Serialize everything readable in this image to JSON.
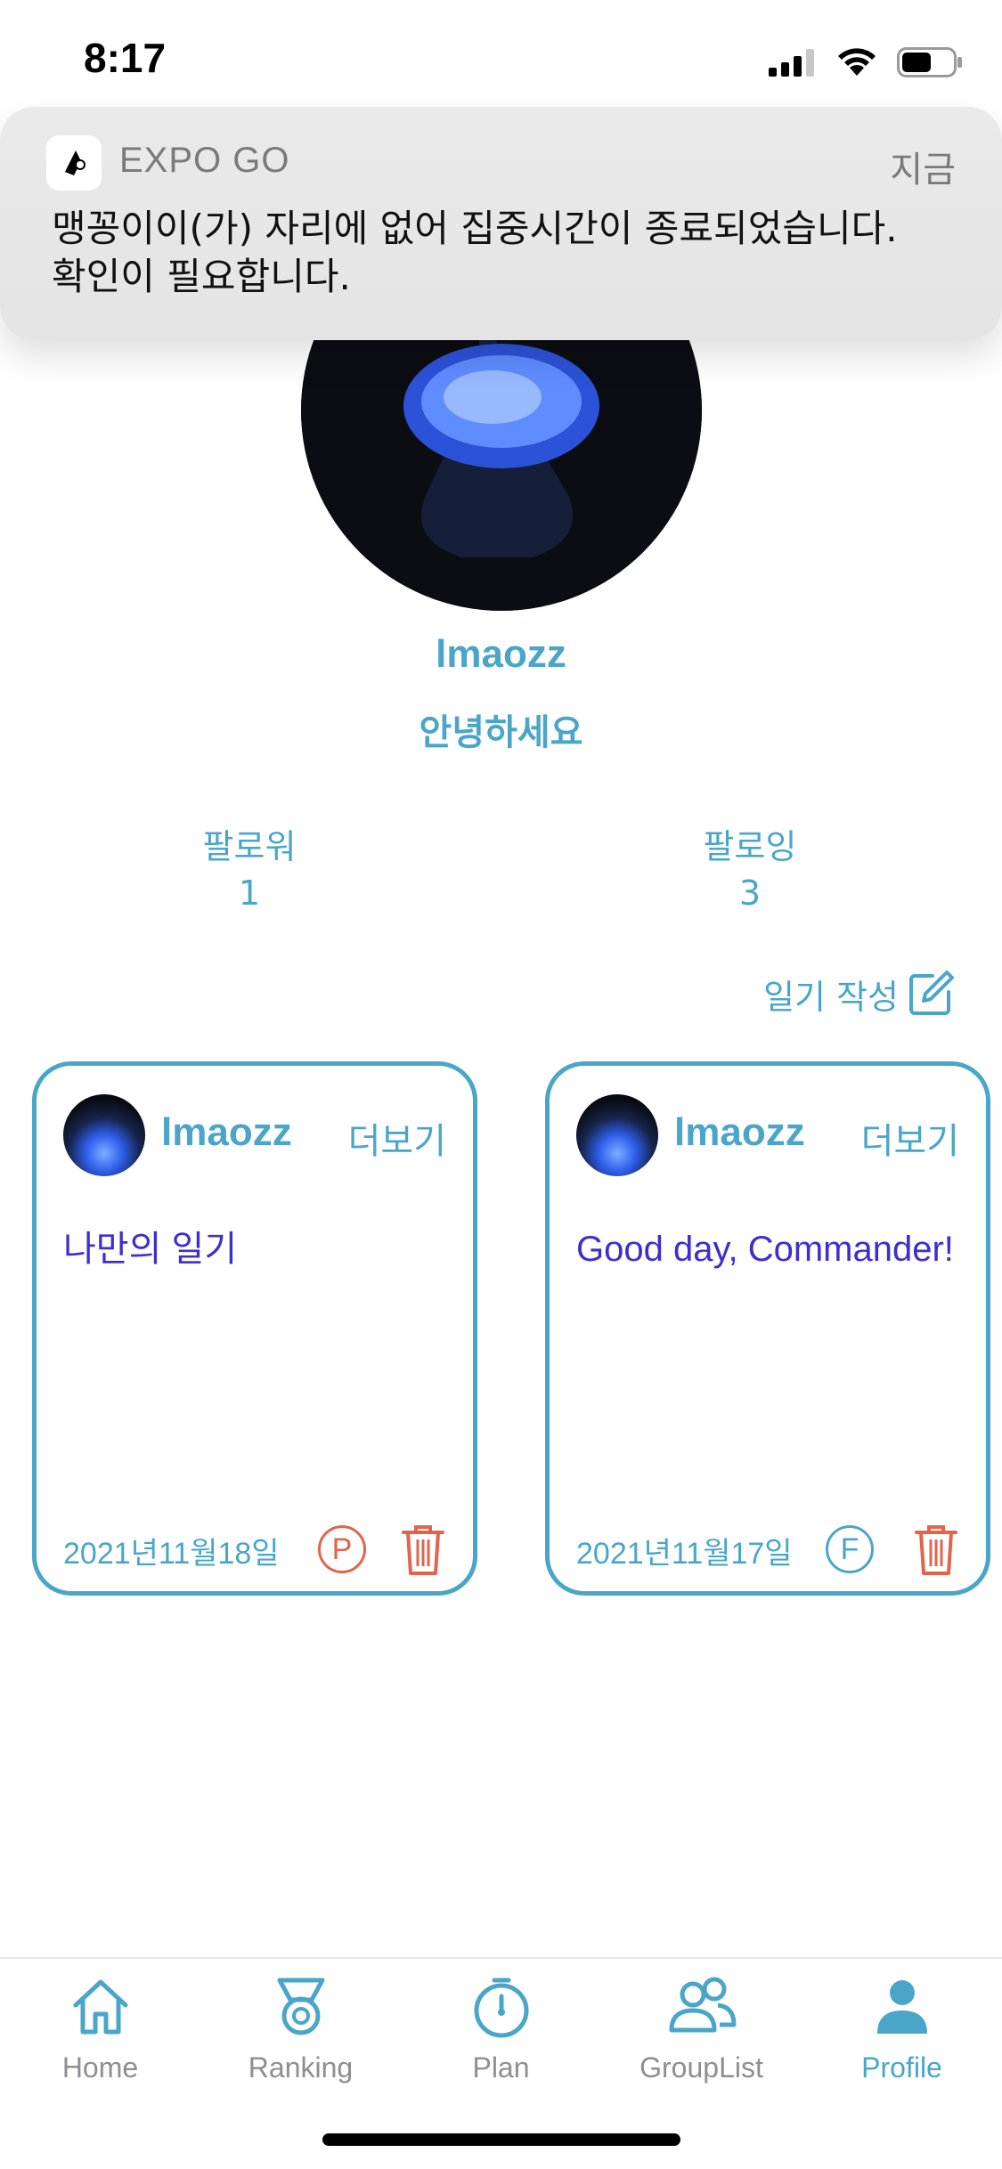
{
  "status_bar": {
    "time": "8:17"
  },
  "notification": {
    "app_name": "EXPO GO",
    "time": "지금",
    "message_line1": "맹꽁이이(가) 자리에 없어 집중시간이 종료되었습니다.",
    "message_line2": "확인이 필요합니다."
  },
  "profile": {
    "username": "lmaozz",
    "bio": "안녕하세요",
    "followers_label": "팔로워",
    "followers_count": "1",
    "following_label": "팔로잉",
    "following_count": "3",
    "write_diary_label": "일기 작성"
  },
  "diaries": [
    {
      "user": "lmaozz",
      "more_label": "더보기",
      "content": "나만의 일기",
      "date": "2021년11월18일",
      "badge": "P"
    },
    {
      "user": "lmaozz",
      "more_label": "더보기",
      "content": "Good day, Commander!",
      "date": "2021년11월17일",
      "badge": "F"
    }
  ],
  "tabs": [
    {
      "label": "Home",
      "icon": "home-icon"
    },
    {
      "label": "Ranking",
      "icon": "medal-icon"
    },
    {
      "label": "Plan",
      "icon": "stopwatch-icon"
    },
    {
      "label": "GroupList",
      "icon": "group-icon"
    },
    {
      "label": "Profile",
      "icon": "person-icon",
      "active": true
    }
  ],
  "colors": {
    "accent": "#4aa6c9",
    "content_text": "#3b2fcf",
    "danger": "#e0654b",
    "inactive": "#8e8e93"
  }
}
